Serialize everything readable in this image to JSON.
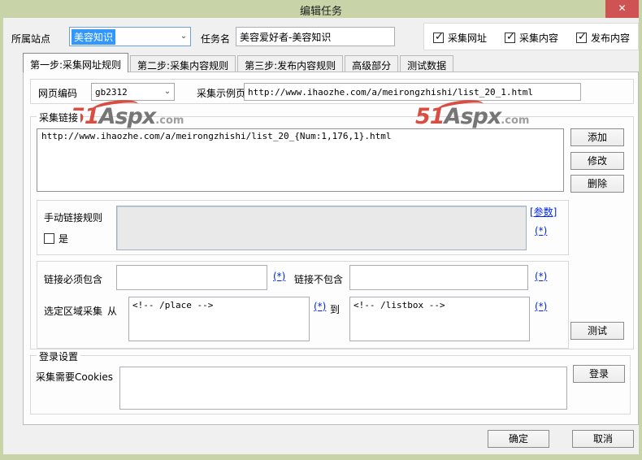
{
  "window": {
    "title": "编辑任务",
    "close_glyph": "✕"
  },
  "header": {
    "site_label": "所属站点",
    "site_value": "美容知识",
    "task_label": "任务名",
    "task_value": "美容爱好者-美容知识",
    "checkboxes": [
      {
        "label": "采集网址",
        "checked": true
      },
      {
        "label": "采集内容",
        "checked": true
      },
      {
        "label": "发布内容",
        "checked": true
      }
    ]
  },
  "tabs": [
    {
      "label": "第一步:采集网址规则",
      "active": true
    },
    {
      "label": "第二步:采集内容规则",
      "active": false
    },
    {
      "label": "第三步:发布内容规则",
      "active": false
    },
    {
      "label": "高级部分",
      "active": false
    },
    {
      "label": "测试数据",
      "active": false
    }
  ],
  "encoding_row": {
    "encoding_label": "网页编码",
    "encoding_value": "gb2312",
    "sample_label": "采集示例页",
    "sample_value": "http://www.ihaozhe.com/a/meirongzhishi/list_20_1.html"
  },
  "watermark": {
    "prefix": "51",
    "middle": "Aspx",
    "suffix": ".com"
  },
  "collect_links": {
    "group_label": "采集链接",
    "list_items": [
      "http://www.ihaozhe.com/a/meirongzhishi/list_20_{Num:1,176,1}.html"
    ],
    "add_button": "添加",
    "modify_button": "修改",
    "delete_button": "删除"
  },
  "manual_rule": {
    "label": "手动链接规则",
    "checkbox_label": "是",
    "checked": false,
    "value": "",
    "params_link": "[参数]",
    "star_link": "(*)"
  },
  "filters": {
    "must_contain_label": "链接必须包含",
    "must_contain_value": "",
    "star1": "(*)",
    "not_contain_label": "链接不包含",
    "not_contain_value": "",
    "star2": "(*)",
    "region_label": "选定区域采集",
    "from_label": "从",
    "from_value": "<!-- /place -->",
    "star3": "(*)",
    "to_label": "到",
    "to_value": "<!-- /listbox -->",
    "star4": "(*)",
    "test_button": "测试"
  },
  "login": {
    "group_label": "登录设置",
    "cookies_label": "采集需要Cookies",
    "cookies_value": "",
    "login_button": "登录"
  },
  "footer": {
    "ok_button": "确定",
    "cancel_button": "取消"
  }
}
